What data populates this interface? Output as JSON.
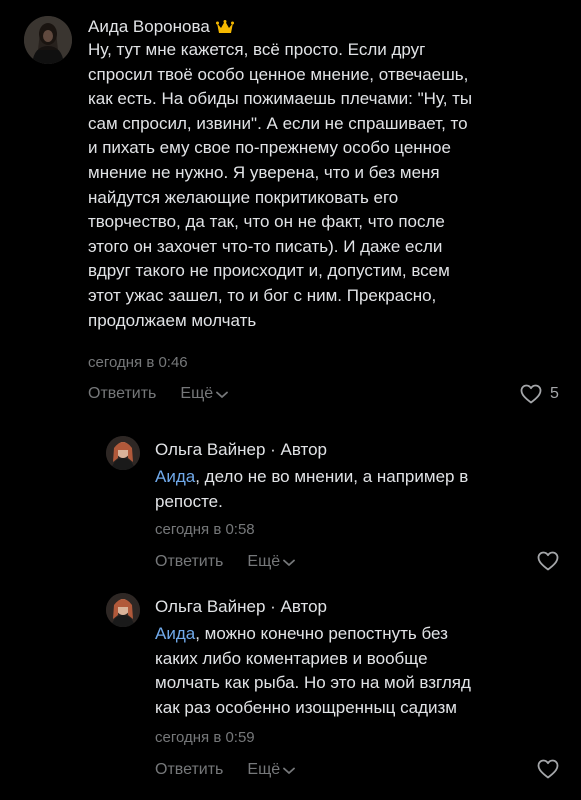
{
  "comments": [
    {
      "author": "Аида Воронова",
      "text": "Ну, тут мне кажется, всё просто. Если друг\nспросил твоё особо ценное мнение, отвечаешь,\nкак есть. На обиды пожимаешь плечами: \"Ну, ты\nсам спросил, извини\". А если не спрашивает, то\nи пихать ему свое по-прежнему особо ценное\nмнение не нужно. Я уверена, что и без меня\nнайдутся желающие покритиковать его\nтворчество, да так, что он не факт, что после\nэтого он захочет что-то писать). И даже если\nвдруг такого не происходит и, допустим, всем\nэтот ужас зашел, то и бог с ним. Прекрасно,\nпродолжаем молчать",
      "time": "сегодня в 0:46",
      "reply_label": "Ответить",
      "more_label": "Ещё",
      "likes": "5"
    },
    {
      "author": "Ольга Вайнер · Автор",
      "mention": "Аида",
      "text": ", дело не во мнении, а например в\nрепосте.",
      "time": "сегодня в 0:58",
      "reply_label": "Ответить",
      "more_label": "Ещё"
    },
    {
      "author": "Ольга Вайнер · Автор",
      "mention": "Аида",
      "text": ", можно конечно репостнуть без\nкаких либо коментариев и вообще\nмолчать как рыба. Но это на мой взгляд\nкак раз особенно изощренныц садизм",
      "time": "сегодня в 0:59",
      "reply_label": "Ответить",
      "more_label": "Ещё"
    }
  ],
  "colors": {
    "background": "#000000",
    "text": "#e1e3e6",
    "secondary": "#76787a",
    "mention": "#71aaeb",
    "crown": "#f5b800"
  },
  "icons": {
    "crown": "crown-icon",
    "heart": "heart-icon",
    "chevron": "chevron-down-icon"
  }
}
